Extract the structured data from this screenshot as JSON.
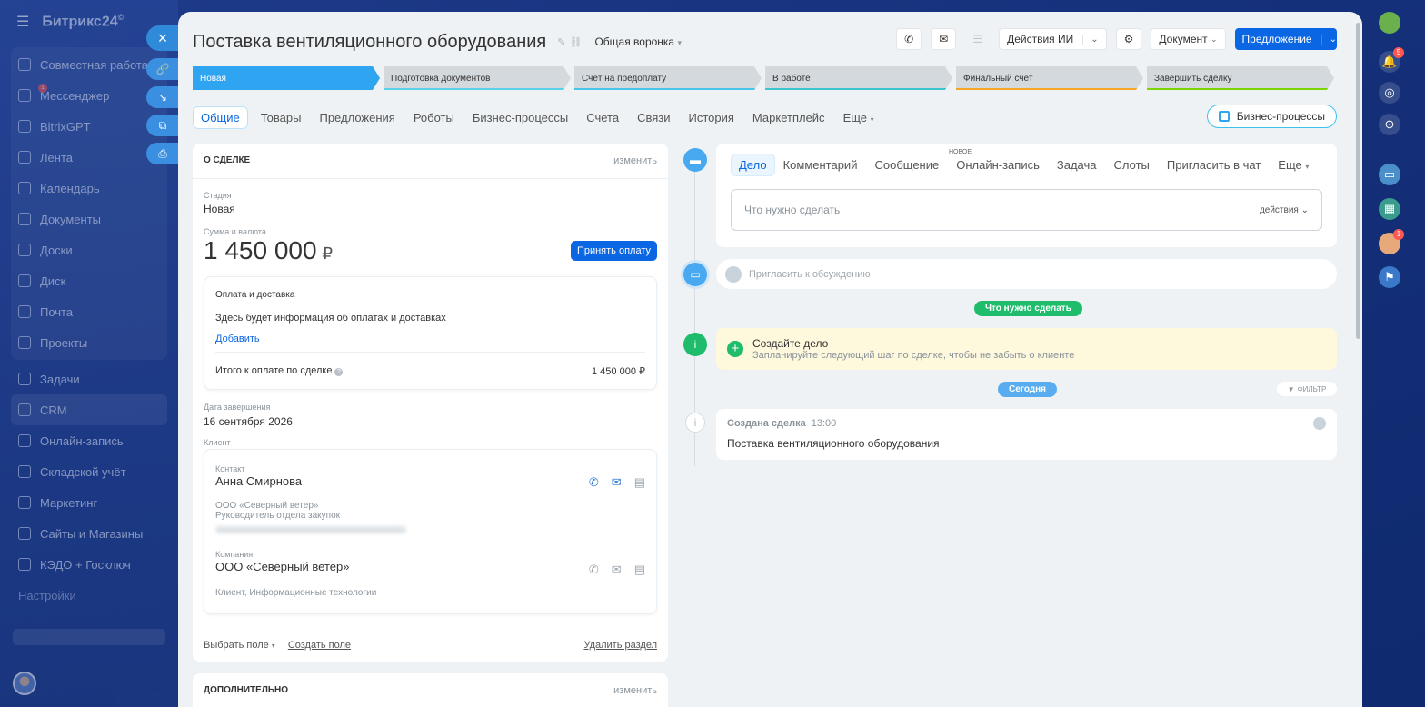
{
  "sidebar": {
    "logo": "Битрикс24",
    "logo_mark": "©",
    "items": [
      {
        "label": "Совместная работа"
      },
      {
        "label": "Мессенджер",
        "badge": "1"
      },
      {
        "label": "BitrixGPT"
      },
      {
        "label": "Лента"
      },
      {
        "label": "Календарь"
      },
      {
        "label": "Документы"
      },
      {
        "label": "Доски"
      },
      {
        "label": "Диск"
      },
      {
        "label": "Почта"
      },
      {
        "label": "Проекты"
      },
      {
        "label": "Задачи"
      },
      {
        "label": "CRM"
      },
      {
        "label": "Онлайн-запись"
      },
      {
        "label": "Складской учёт"
      },
      {
        "label": "Маркетинг"
      },
      {
        "label": "Сайты и Магазины"
      },
      {
        "label": "КЭДО + Госключ"
      },
      {
        "label": "Настройки"
      }
    ]
  },
  "right_bar": {
    "notifications_badge": "5",
    "avatar_badge": "1"
  },
  "deal": {
    "title": "Поставка вентиляционного оборудования",
    "funnel": "Общая воронка"
  },
  "toolbar": {
    "ai_actions": "Действия ИИ",
    "document": "Документ",
    "proposal": "Предложение"
  },
  "stages": [
    {
      "label": "Новая",
      "color": "#2fa4f0"
    },
    {
      "label": "Подготовка документов",
      "color": "#5ad0e8"
    },
    {
      "label": "Счёт на предоплату",
      "color": "#47c5e8"
    },
    {
      "label": "В работе",
      "color": "#3cc4cf"
    },
    {
      "label": "Финальный счёт",
      "color": "#f5a623"
    },
    {
      "label": "Завершить сделку",
      "color": "#7bd500"
    }
  ],
  "tabs": [
    "Общие",
    "Товары",
    "Предложения",
    "Роботы",
    "Бизнес-процессы",
    "Счета",
    "Связи",
    "История",
    "Маркетплейс",
    "Еще"
  ],
  "bp_button": "Бизнес-процессы",
  "about": {
    "header": "О СДЕЛКЕ",
    "edit": "изменить",
    "stage_label": "Стадия",
    "stage_value": "Новая",
    "amount_label": "Сумма и валюта",
    "amount": "1 450 000",
    "currency": "₽",
    "pay_button": "Принять оплату",
    "payment": {
      "title": "Оплата и доставка",
      "desc": "Здесь будет информация об оплатах и доставках",
      "add": "Добавить",
      "total_label": "Итого к оплате по сделке",
      "total_value": "1 450 000 ₽"
    },
    "close_date_label": "Дата завершения",
    "close_date": "16 сентября 2026",
    "client_label": "Клиент",
    "contact": {
      "label": "Контакт",
      "name": "Анна Смирнова",
      "company": "ООО «Северный ветер»",
      "position": "Руководитель отдела закупок"
    },
    "company": {
      "label": "Компания",
      "name": "ООО «Северный ветер»",
      "desc": "Клиент, Информационные технологии"
    },
    "choose_field": "Выбрать поле",
    "create_field": "Создать поле",
    "delete_section": "Удалить раздел"
  },
  "extra": {
    "header": "ДОПОЛНИТЕЛЬНО",
    "edit": "изменить"
  },
  "editor": {
    "tabs": [
      "Дело",
      "Комментарий",
      "Сообщение",
      "Онлайн-запись",
      "Задача",
      "Слоты",
      "Пригласить в чат",
      "Еще"
    ],
    "new_badge": "НОВОЕ",
    "placeholder": "Что нужно сделать",
    "actions": "действия"
  },
  "comment_placeholder": "Пригласить к обсуждению",
  "todo_pill": "Что нужно сделать",
  "todo": {
    "title": "Создайте дело",
    "desc": "Запланируйте следующий шаг по сделке, чтобы не забыть о клиенте"
  },
  "today_pill": "Сегодня",
  "filter": "ФИЛЬТР",
  "created": {
    "title": "Создана сделка",
    "time": "13:00",
    "body": "Поставка вентиляционного оборудования"
  }
}
